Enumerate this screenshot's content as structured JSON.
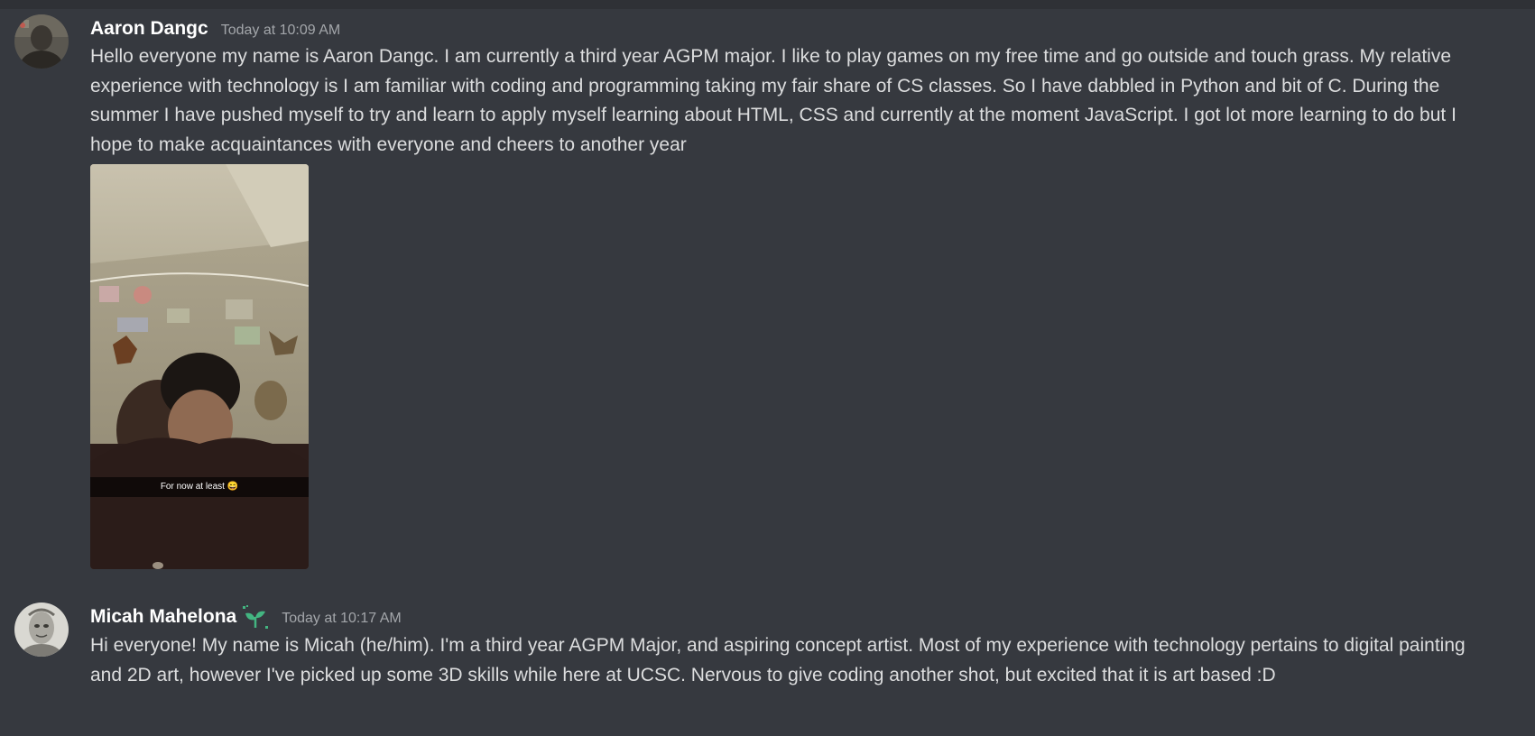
{
  "messages": [
    {
      "author": "Aaron Dangc",
      "timestamp": "Today at 10:09 AM",
      "text": "Hello everyone my name is Aaron Dangc. I am currently a third year AGPM major. I like to play games on my free time and go outside and touch grass. My relative experience with technology is I am familiar with coding and programming taking my fair share of CS classes. So I have dabbled in Python and bit of C. During the summer I have pushed myself to try and learn to apply myself learning about HTML, CSS and currently at the moment JavaScript. I got lot more learning to do but I hope to make acquaintances with everyone and cheers to another year",
      "attachment": {
        "caption": "For now at least 😄"
      }
    },
    {
      "author": "Micah Mahelona",
      "badge_icon": "sprout-icon",
      "timestamp": "Today at 10:17 AM",
      "text": "Hi everyone!  My name is Micah (he/him).  I'm a third year AGPM Major, and aspiring concept artist.  Most of my experience with technology pertains to digital painting and 2D art, however I've picked up some 3D skills while here at UCSC.  Nervous to give coding another shot, but excited that it is art based :D"
    }
  ],
  "colors": {
    "background": "#36393f",
    "username": "#ffffff",
    "text": "#dcddde",
    "timestamp": "#a3a6aa",
    "badge": "#43b581"
  }
}
